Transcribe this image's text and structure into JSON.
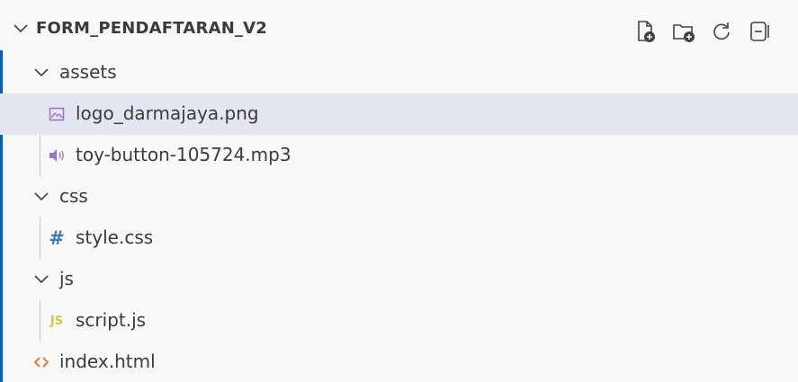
{
  "explorer": {
    "title": "FORM_PENDAFTARAN_V2",
    "actions": [
      {
        "name": "new-file-icon"
      },
      {
        "name": "new-folder-icon"
      },
      {
        "name": "refresh-icon"
      },
      {
        "name": "collapse-all-icon"
      }
    ],
    "tree": {
      "assets": {
        "label": "assets",
        "files": [
          "logo_darmajaya.png",
          "toy-button-105724.mp3"
        ]
      },
      "css": {
        "label": "css",
        "files": [
          "style.css"
        ]
      },
      "js": {
        "label": "js",
        "files": [
          "script.js"
        ]
      },
      "root_files": [
        "index.html"
      ]
    },
    "icons": {
      "image": "image-file-icon",
      "audio": "audio-file-icon",
      "css": "hash-icon",
      "js": "js-icon",
      "html": "html-angle-icon"
    },
    "colors": {
      "accent": "#0b5cad",
      "selected_row": "#e4e6f1",
      "js_icon": "#cbcb41",
      "css_icon": "#3b7bb8",
      "html_icon": "#e37933",
      "image_icon": "#a074c4"
    },
    "js_glyph": "JS",
    "css_glyph": "#"
  }
}
